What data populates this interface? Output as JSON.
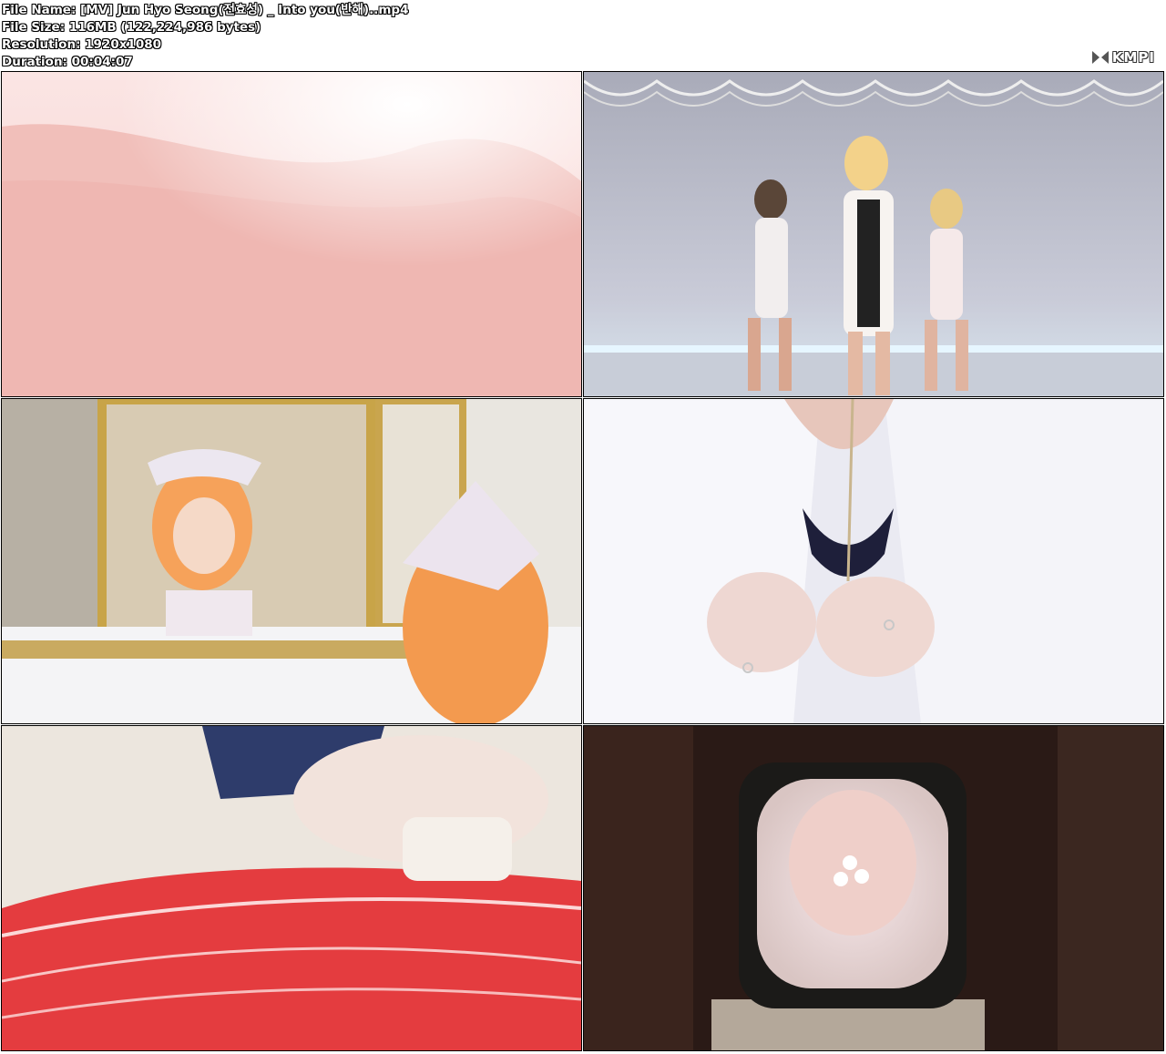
{
  "info": {
    "file_name": "File Name: [MV] Jun Hyo Seong(전효성) _ Into you(반해)..mp4",
    "file_size": "File Size: 116MB (122,224,986 bytes)",
    "resolution": "Resolution: 1920x1080",
    "duration": "Duration: 00:04:07"
  },
  "logo": {
    "text": "KMPI",
    "icon": "kmp-logo-icon"
  },
  "thumbnails": [
    {
      "scene": "pink skin close-up"
    },
    {
      "scene": "three dancers on stage"
    },
    {
      "scene": "woman applying lipstick in mirror"
    },
    {
      "scene": "hands buttoning white shirt"
    },
    {
      "scene": "washing red car with sponge"
    },
    {
      "scene": "retro television with face"
    }
  ]
}
